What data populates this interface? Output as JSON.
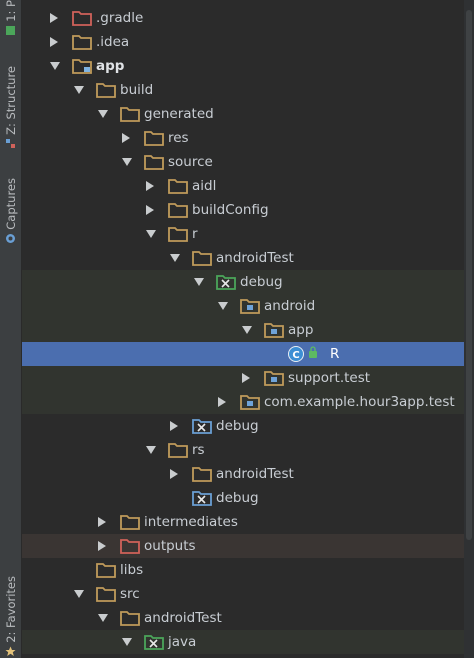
{
  "sidebar": {
    "tabs": [
      {
        "label": "1: P",
        "icon": "project-icon"
      },
      {
        "label": "Z: Structure",
        "icon": "structure-icon"
      },
      {
        "label": "Captures",
        "icon": "captures-icon"
      },
      {
        "label": "2: Favorites",
        "icon": "favorites-icon"
      }
    ]
  },
  "colors": {
    "folder": "#c09b5b",
    "excluded_folder": "#d0625a",
    "package_folder": "#e3c27a",
    "test_folder": "#4ba65a",
    "res_folder": "#6a9fd4",
    "selection": "#4b6eaf"
  },
  "tree": [
    {
      "label": ".gradle",
      "depth": 0,
      "arrow": "right",
      "icon": "folder-excluded-icon",
      "bold": false
    },
    {
      "label": ".idea",
      "depth": 0,
      "arrow": "right",
      "icon": "folder-icon",
      "bold": false
    },
    {
      "label": "app",
      "depth": 0,
      "arrow": "down",
      "icon": "module-folder-icon",
      "bold": true
    },
    {
      "label": "build",
      "depth": 1,
      "arrow": "down",
      "icon": "folder-icon",
      "bold": false
    },
    {
      "label": "generated",
      "depth": 2,
      "arrow": "down",
      "icon": "folder-icon",
      "bold": false
    },
    {
      "label": "res",
      "depth": 3,
      "arrow": "right",
      "icon": "folder-icon",
      "bold": false
    },
    {
      "label": "source",
      "depth": 3,
      "arrow": "down",
      "icon": "folder-icon",
      "bold": false
    },
    {
      "label": "aidl",
      "depth": 4,
      "arrow": "right",
      "icon": "folder-icon",
      "bold": false
    },
    {
      "label": "buildConfig",
      "depth": 4,
      "arrow": "right",
      "icon": "folder-icon",
      "bold": false
    },
    {
      "label": "r",
      "depth": 4,
      "arrow": "down",
      "icon": "folder-icon",
      "bold": false
    },
    {
      "label": "androidTest",
      "depth": 5,
      "arrow": "down",
      "icon": "folder-icon",
      "bold": false
    },
    {
      "label": "debug",
      "depth": 6,
      "arrow": "down",
      "icon": "test-source-folder-icon",
      "bold": false
    },
    {
      "label": "android",
      "depth": 7,
      "arrow": "down",
      "icon": "package-icon",
      "bold": false
    },
    {
      "label": "app",
      "depth": 8,
      "arrow": "down",
      "icon": "package-icon",
      "bold": false
    },
    {
      "label": "R",
      "depth": 9,
      "arrow": "none",
      "icon": "class-file-icon",
      "bold": false,
      "selected": true
    },
    {
      "label": "support.test",
      "depth": 8,
      "arrow": "right",
      "icon": "package-icon",
      "bold": false
    },
    {
      "label": "com.example.hour3app.test",
      "depth": 7,
      "arrow": "right",
      "icon": "package-icon",
      "bold": false
    },
    {
      "label": "debug",
      "depth": 5,
      "arrow": "right",
      "icon": "source-folder-icon",
      "bold": false
    },
    {
      "label": "rs",
      "depth": 4,
      "arrow": "down",
      "icon": "folder-icon",
      "bold": false
    },
    {
      "label": "androidTest",
      "depth": 5,
      "arrow": "right",
      "icon": "folder-icon",
      "bold": false
    },
    {
      "label": "debug",
      "depth": 5,
      "arrow": "none",
      "icon": "source-folder-icon",
      "bold": false
    },
    {
      "label": "intermediates",
      "depth": 2,
      "arrow": "right",
      "icon": "folder-icon",
      "bold": false
    },
    {
      "label": "outputs",
      "depth": 2,
      "arrow": "right",
      "icon": "folder-excluded-icon",
      "bold": false
    },
    {
      "label": "libs",
      "depth": 1,
      "arrow": "none",
      "icon": "folder-icon",
      "bold": false
    },
    {
      "label": "src",
      "depth": 1,
      "arrow": "down",
      "icon": "folder-icon",
      "bold": false
    },
    {
      "label": "androidTest",
      "depth": 2,
      "arrow": "down",
      "icon": "folder-icon",
      "bold": false
    },
    {
      "label": "java",
      "depth": 3,
      "arrow": "down",
      "icon": "test-source-folder-icon",
      "bold": false
    }
  ]
}
